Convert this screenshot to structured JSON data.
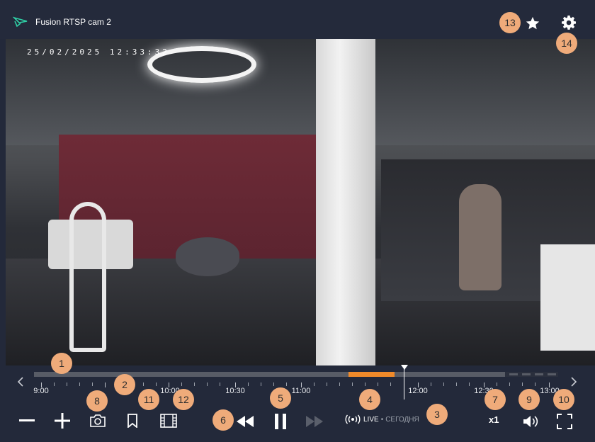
{
  "header": {
    "camera_title": "Fusion RTSP cam 2",
    "icons": [
      "logo-icon",
      "star-icon",
      "gear-icon"
    ]
  },
  "video": {
    "timestamp": "25/02/2025 12:33:32"
  },
  "timeline": {
    "tick_labels": [
      "9:00",
      "10:00",
      "10:30",
      "11:00",
      "12:00",
      "12:30",
      "13:00"
    ],
    "colors": {
      "recorded": "#585c66",
      "highlight": "#f08a2a",
      "future": "#2a2f3d"
    }
  },
  "controls": {
    "icons": [
      "minus-icon",
      "plus-icon",
      "camera-icon",
      "bookmark-icon",
      "film-icon",
      "rewind-icon",
      "pause-icon",
      "fast-forward-icon",
      "volume-icon",
      "fullscreen-icon"
    ],
    "live_label": "LIVE",
    "live_separator": "•",
    "date_label": "СЕГОДНЯ",
    "speed": "x1"
  },
  "annotations": [
    "1",
    "2",
    "3",
    "4",
    "5",
    "6",
    "7",
    "8",
    "9",
    "10",
    "11",
    "12",
    "13",
    "14"
  ],
  "colors": {
    "background": "#23293a",
    "badge": "#efab7a",
    "accent": "#f08a2a",
    "logo": "#2fd0a6"
  }
}
